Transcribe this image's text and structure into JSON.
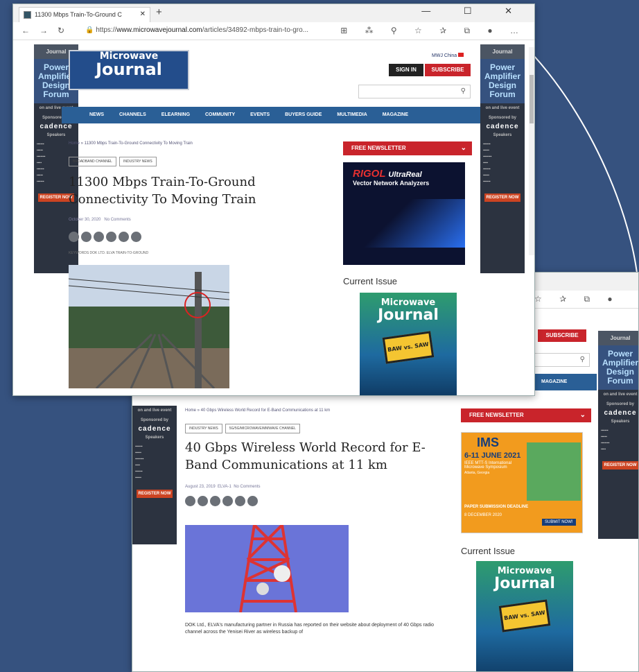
{
  "window_front": {
    "tab_title": "11300 Mbps Train-To-Ground C",
    "url_prefix": "https://",
    "url_domain": "www.microwavejournal.com",
    "url_path": "/articles/34892-mbps-train-to-gro...",
    "article": {
      "breadcrumb": "Home » 11300 Mbps Train-To-Ground Connectivity To Moving Train",
      "tags": [
        "BROADBAND CHANNEL",
        "INDUSTRY NEWS"
      ],
      "title": "11300 Mbps Train-To-Ground Connectivity To Moving Train",
      "date": "October 30, 2020",
      "comments": "No Comments",
      "keywords": "KEYWORDS   DOK LTD.   ELVA   TRAIN-TO-GROUND"
    },
    "ad_sidebar": {
      "brand": "RIGOL",
      "brand_sub": "UltraReal",
      "product": "Vector Network Analyzers"
    }
  },
  "window_back": {
    "article": {
      "breadcrumb": "Home » 40 Gbps Wireless World Record for E-Band Communications at 11 km",
      "tags": [
        "INDUSTRY NEWS",
        "5G/5G/MICROWAVE/MMWAVE CHANNEL"
      ],
      "title": "40 Gbps Wireless World Record for E-Band Communications at 11 km",
      "date": "August 23, 2019",
      "author": "ELVA-1",
      "comments": "No Comments",
      "body": "DOK Ltd., ELVA's manufacturing partner in Russia has reported on their website about deployment of 40 Gbps radio channel across the Yenisei River as wireless backup of"
    },
    "ad_sidebar": {
      "brand": "IMS",
      "dates": "6-11 JUNE 2021",
      "event": "IEEE MTT-S International Microwave Symposium",
      "place": "Atlanta, Georgia",
      "paper": "PAPER SUBMISSION DEADLINE",
      "deadline": "8 DECEMBER 2020",
      "cta": "SUBMIT NOW!"
    }
  },
  "site": {
    "logo_top": "Microwave",
    "logo_bottom": "Journal",
    "region_link": "MWJ China",
    "sign_in": "SIGN IN",
    "subscribe": "SUBSCRIBE",
    "nav": [
      "NEWS",
      "CHANNELS",
      "ELEARNING",
      "COMMUNITY",
      "EVENTS",
      "BUYERS GUIDE",
      "MULTIMEDIA",
      "MAGAZINE"
    ],
    "newsletter": "FREE NEWSLETTER",
    "current_issue": "Current Issue",
    "cover_tag": "BAW vs. SAW"
  },
  "skyscraper_ad": {
    "top": "Journal",
    "title": "Power Amplifier Design Forum",
    "small": "on and live event",
    "sponsor": "Sponsored by",
    "company": "cadence",
    "speakers": "Speakers",
    "register": "REGISTER NOW"
  },
  "colors": {
    "desktop": "#36527f",
    "nav": "#2a5f96",
    "accent": "#c9242b"
  }
}
